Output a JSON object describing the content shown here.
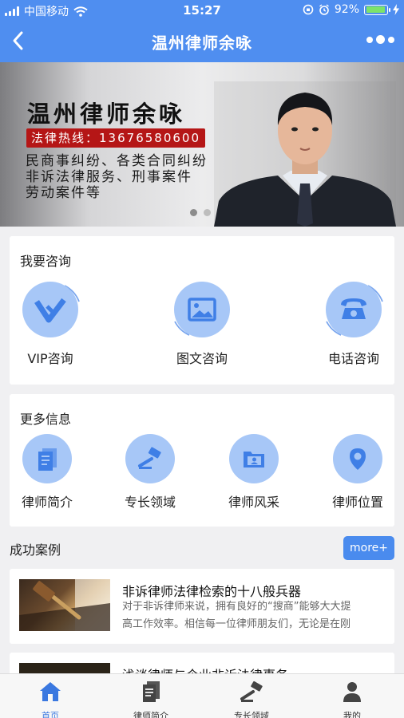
{
  "status_bar": {
    "carrier": "中国移动",
    "time": "15:27",
    "battery": "92%",
    "battery_level": 0.92
  },
  "nav": {
    "title": "温州律师余咏"
  },
  "banner": {
    "title": "温州律师余咏",
    "hotline_label": "法律热线：",
    "hotline_number": "13676580600",
    "line1": "民商事纠纷、各类合同纠纷",
    "line2": "非诉法律服务、刑事案件",
    "line3": "劳动案件等",
    "slides": 2,
    "active_slide": 0
  },
  "consult": {
    "title": "我要咨询",
    "items": [
      {
        "label": "VIP咨询",
        "icon": "vip-icon"
      },
      {
        "label": "图文咨询",
        "icon": "image-icon"
      },
      {
        "label": "电话咨询",
        "icon": "phone-icon"
      }
    ]
  },
  "more_info": {
    "title": "更多信息",
    "items": [
      {
        "label": "律师简介",
        "icon": "document-icon"
      },
      {
        "label": "专长领域",
        "icon": "gavel-icon"
      },
      {
        "label": "律师风采",
        "icon": "folder-user-icon"
      },
      {
        "label": "律师位置",
        "icon": "location-pin-icon"
      }
    ]
  },
  "cases": {
    "title": "成功案例",
    "more_label": "more+",
    "items": [
      {
        "title": "非诉律师法律检索的十八般兵器",
        "desc_line1": "对于非诉律师来说，拥有良好的“搜商”能够大大提",
        "desc_line2": "高工作效率。相信每一位律师朋友们，无论是在刚"
      },
      {
        "title": "浅谈律师与企业非诉法律事务",
        "desc_line1": "",
        "desc_line2": ""
      }
    ]
  },
  "tabbar": {
    "items": [
      {
        "label": "首页",
        "icon": "home-icon"
      },
      {
        "label": "律师简介",
        "icon": "document-icon"
      },
      {
        "label": "专长领域",
        "icon": "gavel-icon"
      },
      {
        "label": "我的",
        "icon": "user-icon"
      }
    ],
    "active": 0
  },
  "colors": {
    "primary": "#4f8ef0",
    "icon_circle": "#a7c7f7",
    "hotline_bg": "#b51616",
    "tab_active": "#3a78e0"
  }
}
